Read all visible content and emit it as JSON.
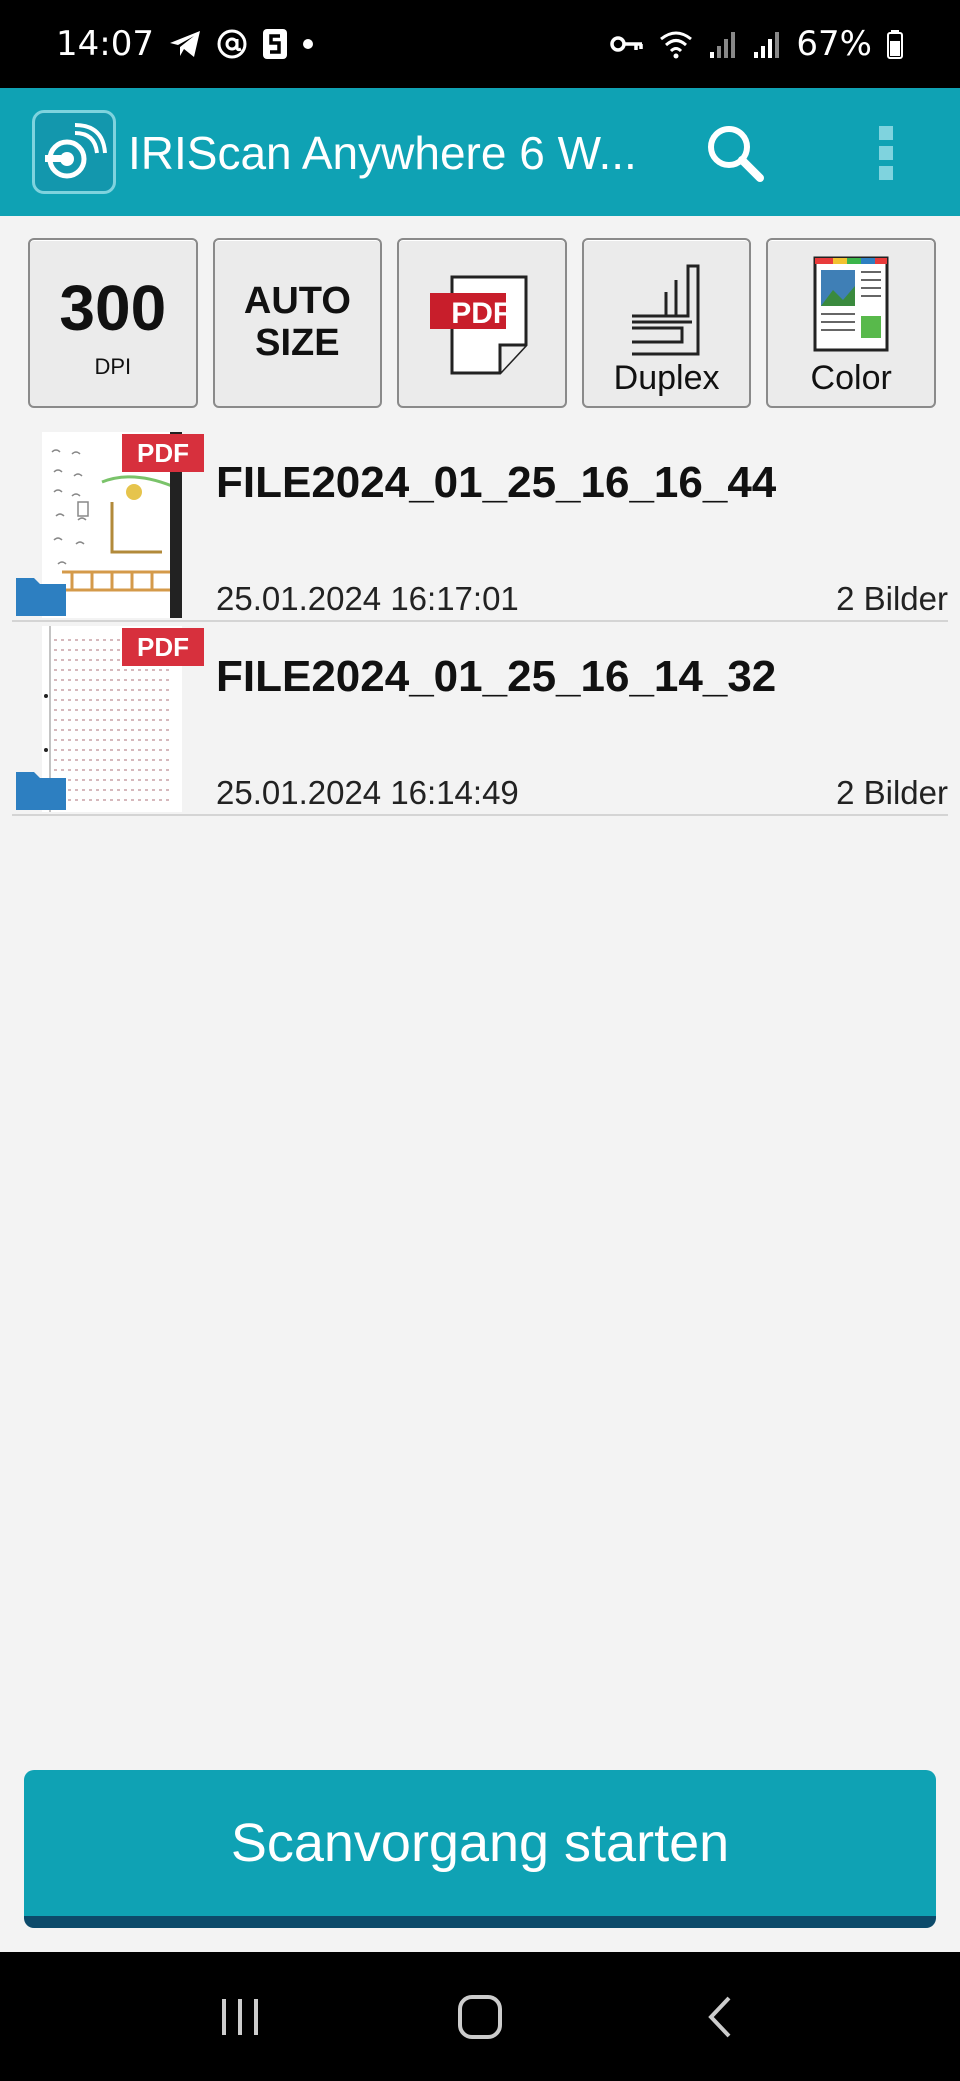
{
  "status_bar": {
    "time": "14:07",
    "battery": "67%"
  },
  "app_bar": {
    "title": "IRIScan Anywhere 6 W..."
  },
  "toolbar": {
    "dpi_value": "300",
    "dpi_unit": "DPI",
    "size_line1": "AUTO",
    "size_line2": "SIZE",
    "format_badge": "PDF",
    "duplex_label": "Duplex",
    "color_label": "Color"
  },
  "files": [
    {
      "name": "FILE2024_01_25_16_16_44",
      "date": "25.01.2024 16:17:01",
      "count": "2 Bilder",
      "badge": "PDF"
    },
    {
      "name": "FILE2024_01_25_16_14_32",
      "date": "25.01.2024 16:14:49",
      "count": "2 Bilder",
      "badge": "PDF"
    }
  ],
  "scan_button": {
    "label": "Scanvorgang starten"
  },
  "colors": {
    "accent": "#0fa2b4",
    "button_shadow": "#0c4a6a",
    "pdf_red": "#d7303d",
    "folder_blue": "#2d7fc1"
  }
}
